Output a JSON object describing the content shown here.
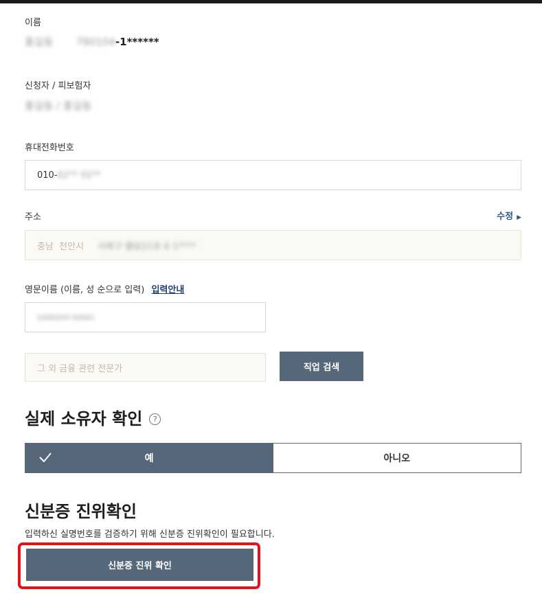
{
  "name": {
    "label": "이름",
    "blurred_name": "홍길동",
    "blurred_id_prefix": "780104",
    "id_suffix": "-1******"
  },
  "applicant": {
    "label": "신청자 / 피보험자",
    "value": "홍길동 / 홍길동"
  },
  "phone": {
    "label": "휴대전화번호",
    "prefix": "010-",
    "blurred_rest": "62** 02**"
  },
  "address": {
    "label": "주소",
    "edit_link": "수정",
    "city": "충남  천안시",
    "blurred_rest": "서북구 불당21로 6 1****"
  },
  "english_name": {
    "label": "영문이름 (이름, 성 순으로 입력)",
    "guide_link": "입력안내",
    "blurred_value": "SANGHO KANG"
  },
  "job": {
    "placeholder": "그 외 금융 관련 전문가",
    "search_button": "직업 검색"
  },
  "owner_check": {
    "title": "실제 소유자 확인",
    "help_glyph": "?",
    "yes": "예",
    "no": "아니오",
    "selected": "yes"
  },
  "id_verify": {
    "title": "신분증 진위확인",
    "description": "입력하신 실명번호를 검증하기 위해 신분증 진위확인이 필요합니다.",
    "button": "신분증 진위 확인"
  },
  "colors": {
    "primary_dark": "#56677a",
    "highlight_red": "#e1131b",
    "link_blue": "#315b80"
  }
}
